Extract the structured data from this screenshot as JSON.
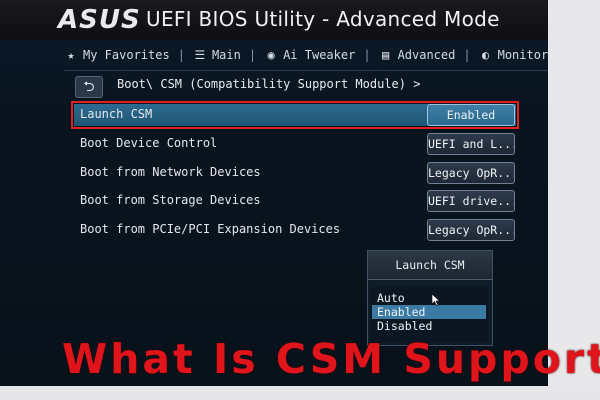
{
  "header": {
    "brand": "ASUS",
    "title": "UEFI BIOS Utility - Advanced Mode"
  },
  "tabs": [
    {
      "label": "My Favorites",
      "icon": "star-icon"
    },
    {
      "label": "Main",
      "icon": "list-icon"
    },
    {
      "label": "Ai Tweaker",
      "icon": "tweaker-icon"
    },
    {
      "label": "Advanced",
      "icon": "advanced-icon"
    },
    {
      "label": "Monitor",
      "icon": "monitor-icon"
    }
  ],
  "breadcrumb": "Boot\\ CSM (Compatibility Support Module) >",
  "settings": [
    {
      "label": "Launch CSM",
      "value": "Enabled"
    },
    {
      "label": "Boot Device Control",
      "value": "UEFI and L..."
    },
    {
      "label": "Boot from Network Devices",
      "value": "Legacy OpR..."
    },
    {
      "label": "Boot from Storage Devices",
      "value": "UEFI drive..."
    },
    {
      "label": "Boot from PCIe/PCI Expansion Devices",
      "value": "Legacy OpR..."
    }
  ],
  "popup": {
    "title": "Launch CSM",
    "options": [
      "Auto",
      "Enabled",
      "Disabled"
    ],
    "highlighted": "Enabled"
  },
  "caption": "What Is CSM Support",
  "colors": {
    "accent": "#2c6a90",
    "highlight_border": "#e32020",
    "caption": "#e0151c"
  }
}
